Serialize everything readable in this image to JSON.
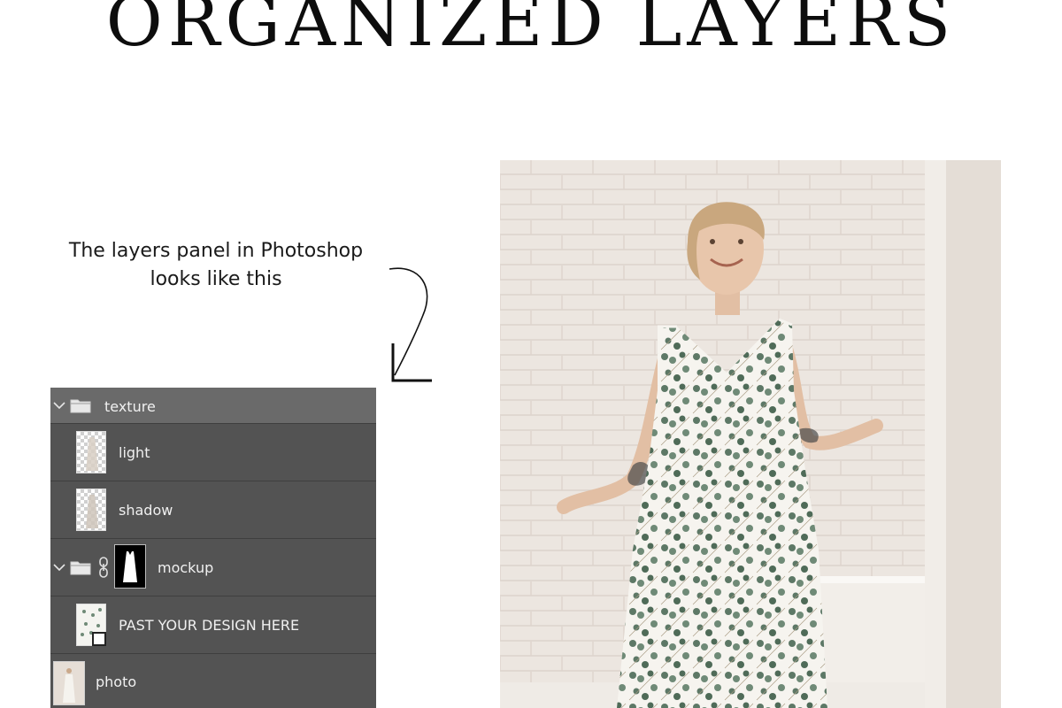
{
  "heading": "ORGANIZED LAYERS",
  "caption": {
    "line1": "The layers panel in Photoshop",
    "line2": "looks like this"
  },
  "layers_panel": {
    "rows": [
      {
        "label": "texture",
        "type": "group",
        "expanded": true,
        "icon": "folder-icon"
      },
      {
        "label": "light",
        "type": "layer",
        "icon": "dress-thumbnail"
      },
      {
        "label": "shadow",
        "type": "layer",
        "icon": "dress-thumbnail"
      },
      {
        "label": "mockup",
        "type": "group",
        "expanded": true,
        "icon": "folder-icon",
        "mask": "dress-mask"
      },
      {
        "label": "PAST YOUR DESIGN HERE",
        "type": "smart-object",
        "icon": "pattern-thumbnail"
      },
      {
        "label": "photo",
        "type": "layer",
        "icon": "photo-thumbnail"
      }
    ]
  },
  "colors": {
    "panel_bg": "#535353",
    "group_row_bg": "#6a6a6a",
    "panel_text": "#f0f0f0",
    "wall": "#ece6e0",
    "dress": "#f6f4ef",
    "leaf": "#5d7866"
  }
}
